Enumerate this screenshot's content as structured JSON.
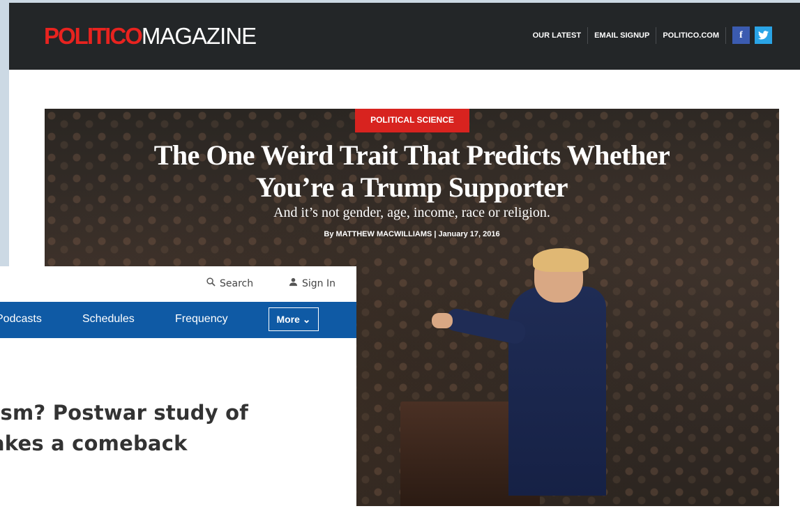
{
  "politico": {
    "logo_red": "POLITICO",
    "logo_white": "MAGAZINE",
    "nav": [
      "OUR LATEST",
      "EMAIL SIGNUP",
      "POLITICO.COM"
    ],
    "facebook_glyph": "f",
    "twitter_glyph": "🐦",
    "article": {
      "tag": "POLITICAL SCIENCE",
      "headline_line1": "The One Weird Trait That Predicts Whether",
      "headline_line2": "You’re a Trump Supporter",
      "dek": "And it’s not gender, age, income, race or religion.",
      "byline": "By MATTHEW MACWILLIAMS | January 17, 2016"
    },
    "colors": {
      "header_bg": "#232628",
      "brand_red": "#e8231f",
      "tag_red": "#d8231f"
    }
  },
  "overlay": {
    "search_label": "Search",
    "signin_label": "Sign In",
    "nav": [
      "Podcasts",
      "Schedules",
      "Frequency"
    ],
    "more_label": "More ⌄",
    "headline_line1": "cism? Postwar study of",
    "headline_line2": "akes a comeback",
    "colors": {
      "nav_bg": "#0f5aa5"
    }
  }
}
